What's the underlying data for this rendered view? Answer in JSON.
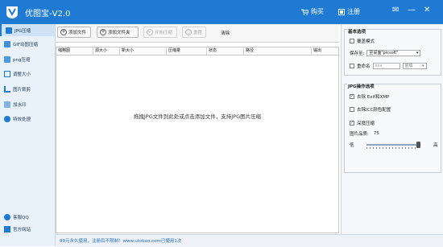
{
  "app": {
    "title": "优图宝-V2.0"
  },
  "titlebar": {
    "buy_label": "购买",
    "register_label": "注册"
  },
  "sidebar": {
    "items": [
      {
        "label": "JPG压缩",
        "icon": "jpg-icon",
        "active": true
      },
      {
        "label": "GIF动图压缩",
        "icon": "gif-icon",
        "active": false
      },
      {
        "label": "png压缩",
        "icon": "png-icon",
        "active": false
      },
      {
        "label": "调整大小",
        "icon": "resize-icon",
        "active": false
      },
      {
        "label": "图片裁剪",
        "icon": "crop-icon",
        "active": false
      },
      {
        "label": "加水印",
        "icon": "watermark-icon",
        "active": false
      },
      {
        "label": "特效处理",
        "icon": "effects-icon",
        "active": false
      }
    ],
    "bottom": [
      {
        "label": "客服QQ",
        "icon": "qq-icon"
      },
      {
        "label": "官方网站",
        "icon": "home-icon"
      }
    ]
  },
  "toolbar": {
    "add_file_label": "添加文件",
    "add_folder_label": "添加文件夹",
    "start_label": "开始压缩",
    "reset_label": "重置",
    "clear_label": "清除"
  },
  "table": {
    "columns": [
      "缩略图",
      "源大小",
      "新大小",
      "压缩量",
      "状态",
      "路径",
      "输出"
    ],
    "drop_hint": "拖拽JPG文件到此处或点击添加文件，支持JPG图片压缩"
  },
  "status": {
    "text": "99元永久使用，注册后不限制！www.utobao.com已使用1次"
  },
  "basic_settings": {
    "title": "基本选项",
    "overwrite_label": "覆盖模式",
    "save_to_label": "保存至:",
    "save_to_value": "至桌面\"picsoft\"",
    "rename_label": "重命名",
    "rename_placeholder": "xxx_",
    "rename_position": "前缀"
  },
  "jpg_options": {
    "title": "JPG操作选项",
    "strip_exif_label": "去除 Exif和XMP",
    "strip_icc_label": "去除ICC颜色配置",
    "deep_compress_label": "深度压缩",
    "quality_label": "图片品质:",
    "quality_value": "75",
    "low_label": "低",
    "high_label": "高",
    "quality_slider": {
      "min": 0,
      "max": 100,
      "value": 100
    }
  },
  "colors": {
    "accent": "#1f7ad3",
    "sidebar_bg": "#e9f1fa"
  }
}
